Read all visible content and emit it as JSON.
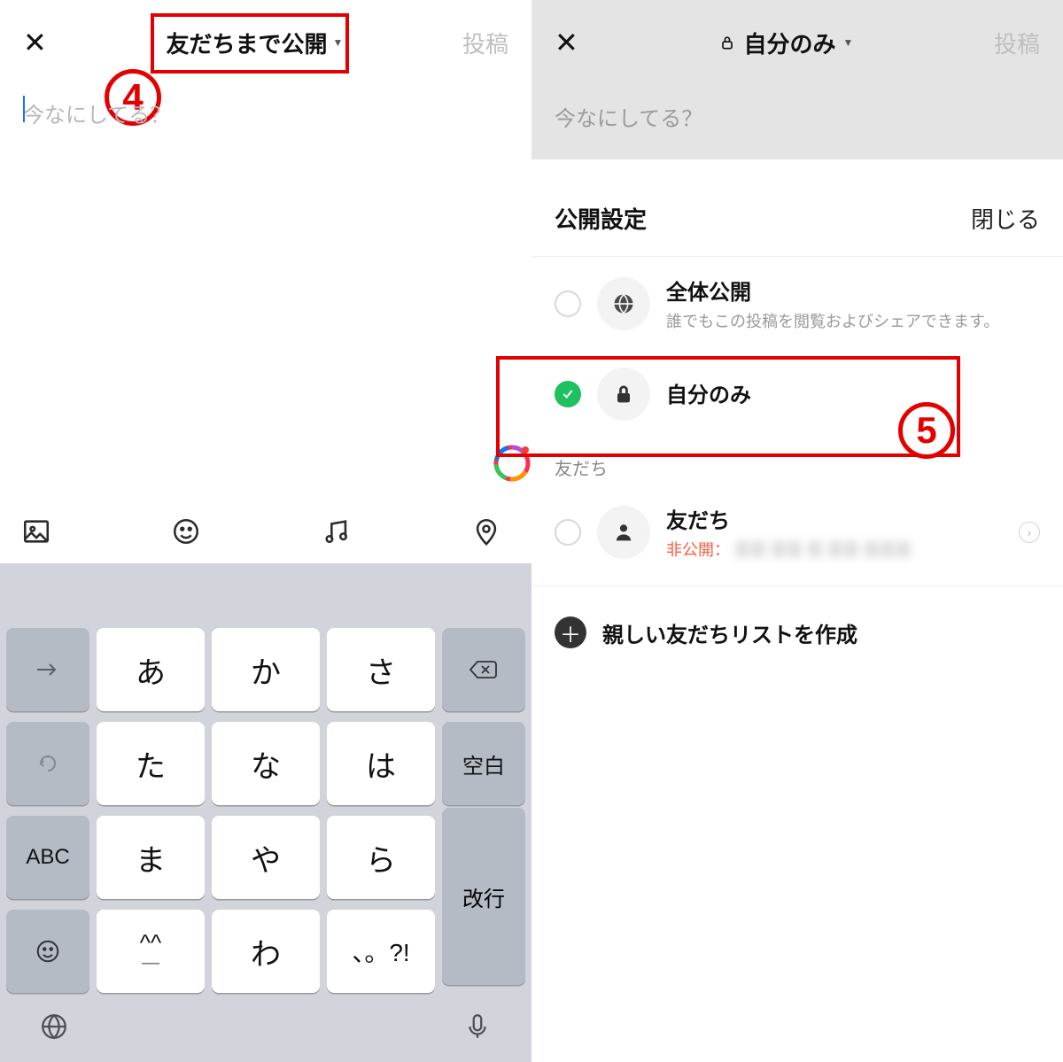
{
  "left": {
    "header": {
      "close": "✕",
      "privacy_label": "友だちまで公開",
      "post": "投稿"
    },
    "compose_placeholder": "今なにしてる？",
    "annotation_badge": "4",
    "keyboard": {
      "rows": [
        [
          "→",
          "あ",
          "か",
          "さ",
          "⌫"
        ],
        [
          "↺",
          "た",
          "な",
          "は",
          "空白"
        ],
        [
          "ABC",
          "ま",
          "や",
          "ら",
          ""
        ],
        [
          "☺",
          "^^",
          "わ",
          "、。?!",
          ""
        ]
      ],
      "enter": "改行"
    }
  },
  "right": {
    "header": {
      "close": "✕",
      "privacy_label": "自分のみ",
      "post": "投稿"
    },
    "compose_placeholder": "今なにしてる？",
    "sheet_title": "公開設定",
    "sheet_close": "閉じる",
    "options": {
      "public": {
        "title": "全体公開",
        "sub": "誰でもこの投稿を閲覧およびシェアできます。"
      },
      "only_me": {
        "title": "自分のみ"
      },
      "friends_section": "友だち",
      "friends": {
        "title": "友だち",
        "sub_prefix": "非公開："
      }
    },
    "create_list": "親しい友だちリストを作成",
    "annotation_badge": "5"
  }
}
